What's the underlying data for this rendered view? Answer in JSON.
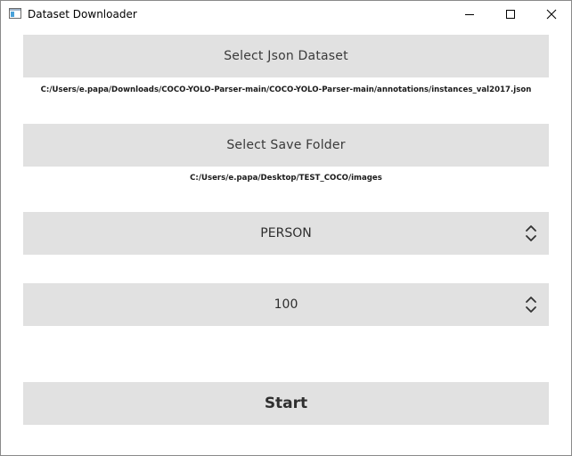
{
  "window": {
    "title": "Dataset Downloader",
    "icons": [
      "app-icon",
      "minimize-icon",
      "maximize-icon",
      "close-icon"
    ]
  },
  "json_dataset": {
    "button_label": "Select Json Dataset",
    "path": "C:/Users/e.papa/Downloads/COCO-YOLO-Parser-main/COCO-YOLO-Parser-main/annotations/instances_val2017.json"
  },
  "save_folder": {
    "button_label": "Select Save Folder",
    "path": "C:/Users/e.papa/Desktop/TEST_COCO/images"
  },
  "class_select": {
    "value": "PERSON",
    "icon": "up-down-chevron-icon"
  },
  "count_spinner": {
    "value": "100",
    "icon": "up-down-chevron-icon"
  },
  "start": {
    "label": "Start"
  },
  "colors": {
    "button_bg": "#e1e1e1",
    "window_bg": "#ffffff",
    "text": "#3a3a3a"
  }
}
